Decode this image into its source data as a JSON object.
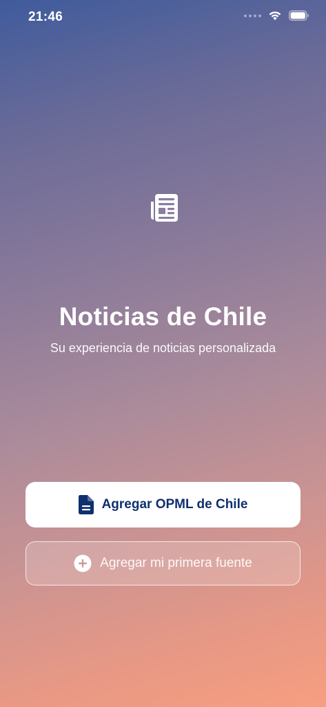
{
  "status_bar": {
    "time": "21:46",
    "icons": [
      "signal-icon",
      "wifi-icon",
      "battery-icon"
    ]
  },
  "hero": {
    "icon": "newspaper-icon",
    "title": "Noticias de Chile",
    "subtitle": "Su experiencia de noticias personalizada"
  },
  "actions": {
    "primary": {
      "icon": "document-icon",
      "label": "Agregar OPML de Chile"
    },
    "secondary": {
      "icon": "plus-circle-icon",
      "label": "Agregar mi primera fuente"
    }
  },
  "colors": {
    "gradient_top": "#3f5b9c",
    "gradient_bottom": "#f79e80",
    "primary_text": "#0f2f6e",
    "white": "#ffffff"
  }
}
